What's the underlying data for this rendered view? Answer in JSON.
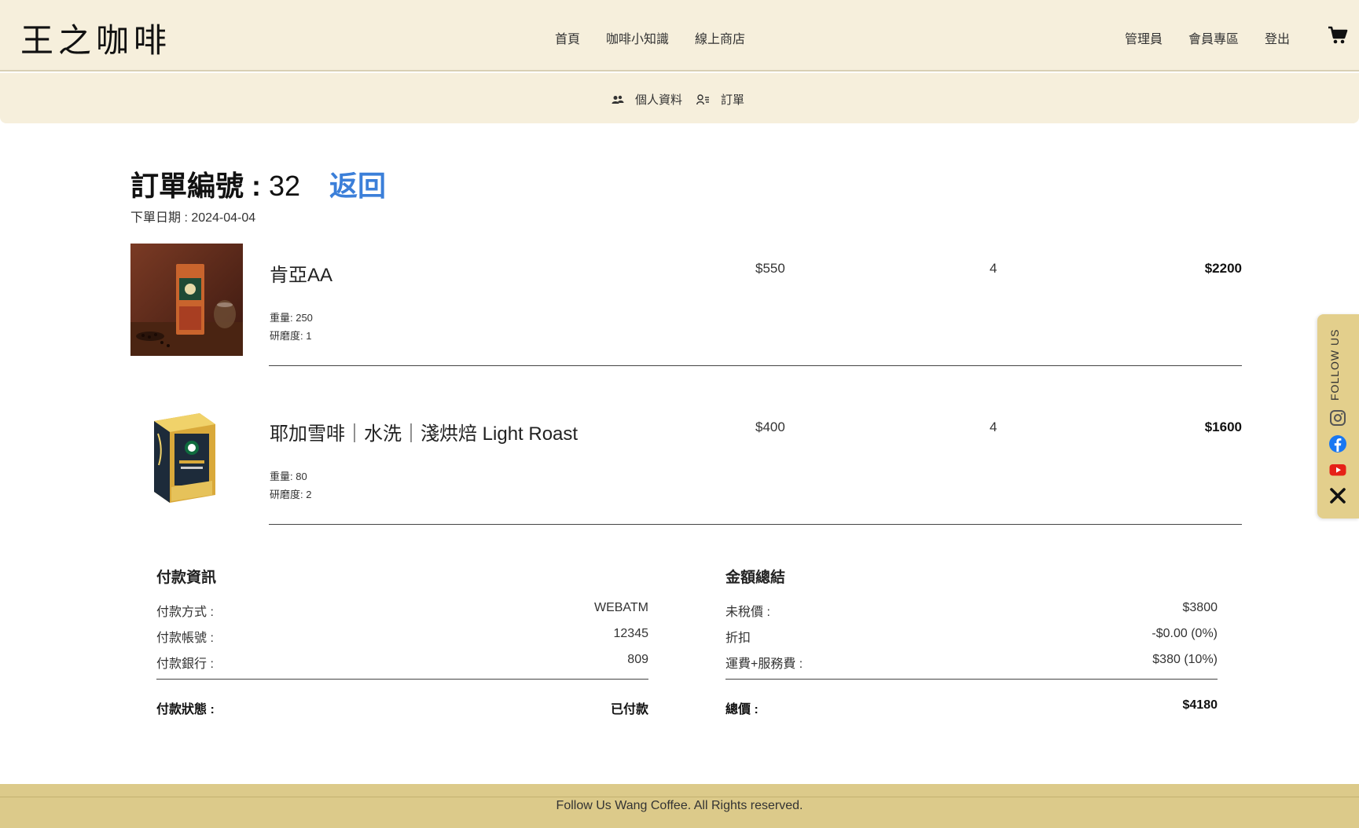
{
  "header": {
    "logo": "王之咖啡",
    "nav_center": [
      "首頁",
      "咖啡小知識",
      "線上商店"
    ],
    "nav_right": [
      "管理員",
      "會員專區",
      "登出"
    ],
    "cart_icon": "cart-icon"
  },
  "subnav": {
    "profile_label": "個人資料",
    "orders_label": "訂單"
  },
  "order": {
    "title_prefix": "訂單編號 : ",
    "number": "32",
    "back_label": "返回",
    "date_text": "下單日期 : 2024-04-04"
  },
  "items": [
    {
      "name": "肯亞AA",
      "price": "$550",
      "qty": "4",
      "total": "$2200",
      "weight": "重量: 250",
      "grind": "研磨度: 1"
    },
    {
      "name": "耶加雪啡｜水洗｜淺烘焙 Light Roast",
      "price": "$400",
      "qty": "4",
      "total": "$1600",
      "weight": "重量: 80",
      "grind": "研磨度: 2"
    }
  ],
  "payment": {
    "heading": "付款資訊",
    "rows": [
      {
        "label": "付款方式 :",
        "value": "WEBATM"
      },
      {
        "label": "付款帳號 :",
        "value": "12345"
      },
      {
        "label": "付款銀行 :",
        "value": "809"
      }
    ],
    "status_label": "付款狀態 :",
    "status_value": "已付款"
  },
  "totals": {
    "heading": "金額總結",
    "rows": [
      {
        "label": "未稅價 :",
        "value": "$3800"
      },
      {
        "label": "折扣",
        "value": "-$0.00 (0%)"
      },
      {
        "label": "運費+服務費 :",
        "value": "$380 (10%)"
      }
    ],
    "total_label": "總價 :",
    "total_value": "$4180"
  },
  "follow": {
    "label": "FOLLOW US",
    "icons": [
      "instagram-icon",
      "facebook-icon",
      "youtube-icon",
      "x-icon"
    ],
    "colors": {
      "facebook": "#1877f2",
      "youtube": "#e62117",
      "instagram": "#555555"
    }
  },
  "footer": {
    "text": "Follow Us Wang Coffee. All Rights reserved."
  },
  "colors": {
    "header_bg": "#f6efdc",
    "footer_bg": "#dcca8a",
    "follow_bg": "#e3cf8c",
    "link": "#3b7fd9"
  }
}
